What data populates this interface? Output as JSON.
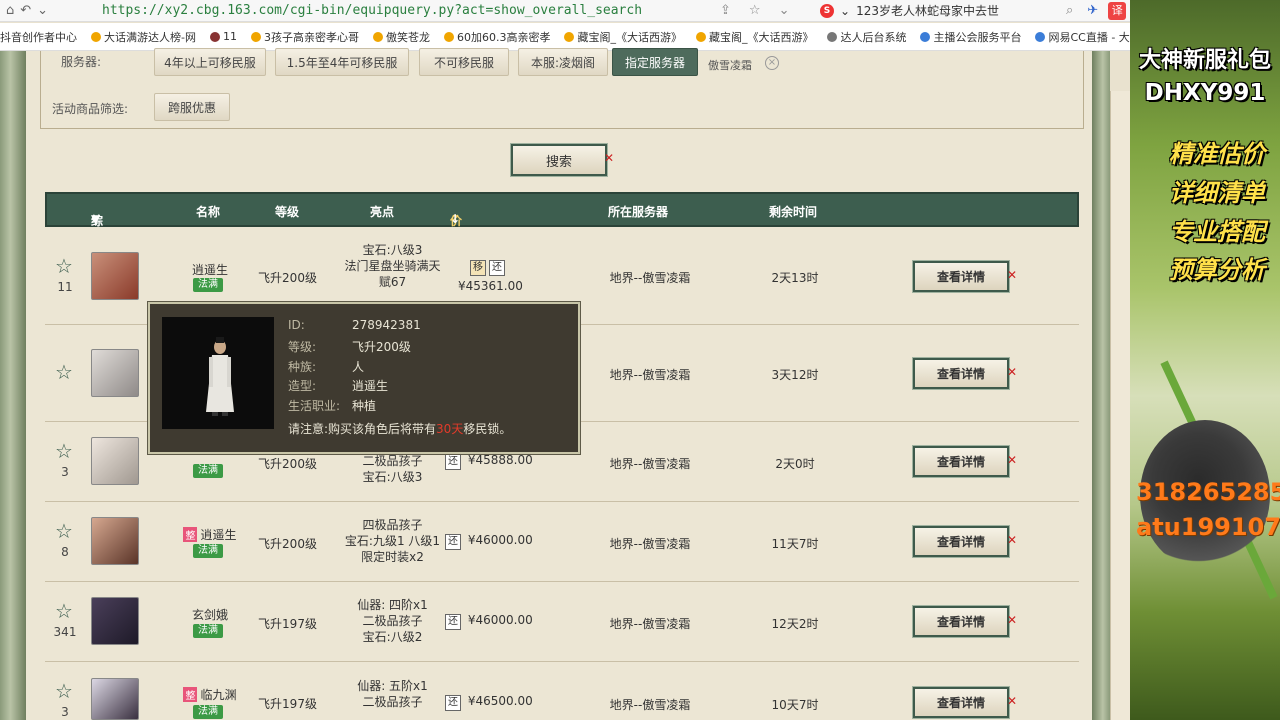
{
  "browser": {
    "url": "https://xy2.cbg.163.com/cgi-bin/equipquery.py?act=show_overall_search",
    "tab_title": "123岁老人林蛇母家中去世",
    "ext_label": "译"
  },
  "bookmarks": [
    "抖音创作者中心",
    "大话满游达人榜-网",
    "11",
    "3孩子高亲密孝心哥",
    "傲笑苍龙",
    "60加60.3高亲密孝",
    "藏宝阁_《大话西游》",
    "藏宝阁_《大话西游》",
    "达人后台系统",
    "主播公会服务平台",
    "网易CC直播 - 大"
  ],
  "filters": {
    "server_label": "服务器:",
    "server_options": [
      "4年以上可移民服",
      "1.5年至4年可移民服",
      "不可移民服",
      "本服:凌烟阁",
      "指定服务器"
    ],
    "selected_server": "傲雪凌霜",
    "activity_label": "活动商品筛选:",
    "activity_option": "跨服优惠",
    "search_label": "搜索"
  },
  "table": {
    "headers": {
      "sort": "综合排序",
      "name": "名称",
      "level": "等级",
      "highlight": "亮点",
      "price": "价格(元)",
      "server": "所在服务器",
      "remain": "剩余时间"
    },
    "detail_label": "查看详情",
    "fa_label": "法满",
    "zheng_label": "整",
    "rows": [
      {
        "fav": "11",
        "name": "逍遥生",
        "level": "飞升200级",
        "highlights": [
          "宝石:八级3",
          "法门星盘坐骑满天",
          "赋67"
        ],
        "tags": [
          "移",
          "还"
        ],
        "price": "¥45361.00",
        "server": "地界--傲雪凌霜",
        "remain": "2天13时"
      },
      {
        "fav": "",
        "name": "",
        "level": "",
        "highlights": [],
        "tags": [],
        "price": "",
        "server": "地界--傲雪凌霜",
        "remain": "3天12时"
      },
      {
        "fav": "3",
        "name": "",
        "level": "飞升200级",
        "highlights": [
          "二极品孩子",
          "宝石:八级3"
        ],
        "tags": [
          "还"
        ],
        "price": "¥45888.00",
        "server": "地界--傲雪凌霜",
        "remain": "2天0时"
      },
      {
        "fav": "8",
        "name": "逍遥生",
        "level": "飞升200级",
        "highlights": [
          "四极品孩子",
          "宝石:九级1 八级1",
          "限定时装x2"
        ],
        "tags": [
          "还"
        ],
        "price": "¥46000.00",
        "server": "地界--傲雪凌霜",
        "remain": "11天7时"
      },
      {
        "fav": "341",
        "name": "玄剑娥",
        "level": "飞升197级",
        "highlights": [
          "仙器: 四阶x1",
          "二极品孩子",
          "宝石:八级2"
        ],
        "tags": [
          "还"
        ],
        "price": "¥46000.00",
        "server": "地界--傲雪凌霜",
        "remain": "12天2时"
      },
      {
        "fav": "3",
        "name": "临九渊",
        "level": "飞升197级",
        "highlights": [
          "仙器: 五阶x1",
          "二极品孩子"
        ],
        "tags": [
          "还"
        ],
        "price": "¥46500.00",
        "server": "地界--傲雪凌霜",
        "remain": "10天7时"
      }
    ]
  },
  "popup": {
    "id_label": "ID:",
    "id": "278942381",
    "level_label": "等级:",
    "level": "飞升200级",
    "race_label": "种族:",
    "race": "人",
    "model_label": "造型:",
    "model": "逍遥生",
    "job_label": "生活职业:",
    "job": "种植",
    "note_pre": "请注意:购买该角色后将带有",
    "note_red": "30天",
    "note_post": "移民锁。"
  },
  "ad": {
    "line1": "大神新服礼包",
    "line2": "DHXY991",
    "line3": "精准估价",
    "line4": "详细清单",
    "line5": "专业搭配",
    "line6": "预算分析",
    "line7": "318265285",
    "line8": "atu199107"
  }
}
